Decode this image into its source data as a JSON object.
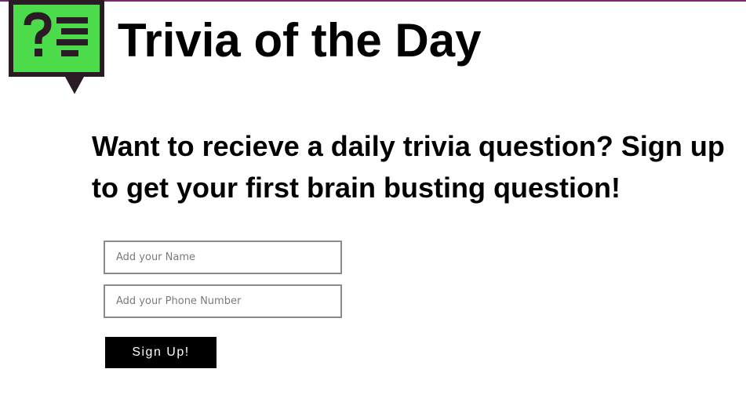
{
  "colors": {
    "accent_green": "#4bdb4b",
    "logo_dark": "#2a1b24",
    "top_border": "#7a2a6a",
    "input_border": "#8a8a8a",
    "button_background": "#000000",
    "button_text": "#ffffff"
  },
  "logo": {
    "icon": "question-list-speech-bubble-icon"
  },
  "header": {
    "title": "Trivia of the Day"
  },
  "main": {
    "headline": "Want to recieve a daily trivia question? Sign up to get your first brain busting question!"
  },
  "form": {
    "name_placeholder": "Add your Name",
    "phone_placeholder": "Add your Phone Number",
    "submit_label": "Sign Up!"
  }
}
